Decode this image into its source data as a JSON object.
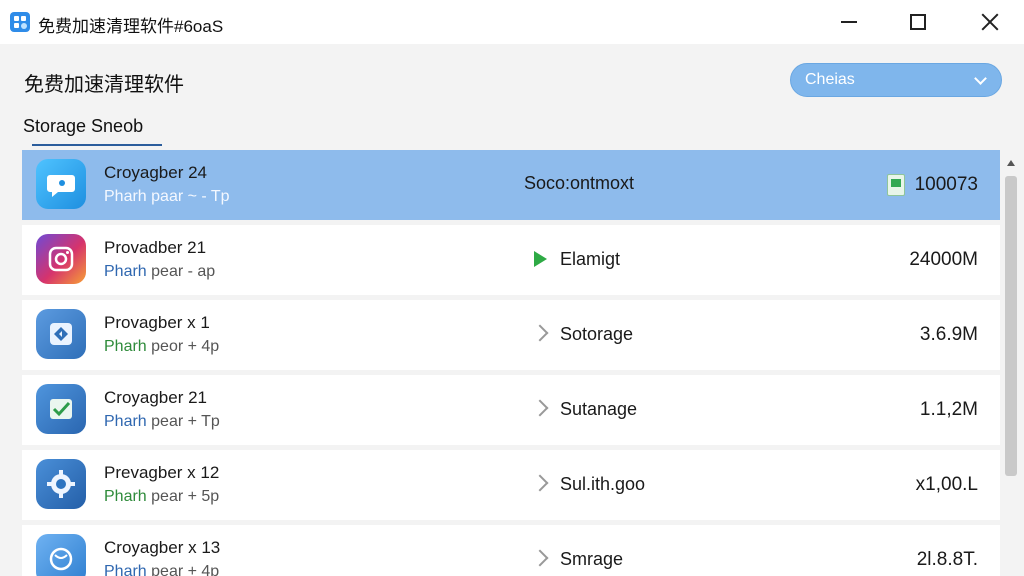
{
  "window": {
    "title": "免费加速清理软件#6oaS"
  },
  "header": {
    "title": "免费加速清理软件",
    "dropdown_value": "Cheias",
    "tab_label": "Storage Sneob"
  },
  "rows": [
    {
      "name": "Croyagber 24",
      "sub_prefix": "Pharh paar",
      "sub_suffix": " ~ - Tp",
      "middle": "Soco:ontmoxt",
      "middle_icon": "none",
      "right": "100073",
      "right_icon": "file-icon",
      "icon": "chat-bubble-icon",
      "icon_color": "#1fa3e8",
      "selected": true
    },
    {
      "name": "Provadber 21",
      "sub_prefix": "Pharh",
      "sub_suffix": " pear - ap",
      "middle": "Elamigt",
      "middle_icon": "play-icon",
      "right": "24000M",
      "right_icon": "none",
      "icon": "instagram-icon",
      "icon_color": "#d6336c",
      "selected": false
    },
    {
      "name": "Provagber x 1",
      "sub_prefix": "Pharh",
      "sub_suffix": " peor + 4p",
      "middle": "Sotorage",
      "middle_icon": "chevron-right-icon",
      "right": "3.6.9M",
      "right_icon": "none",
      "icon": "diamond-tile-icon",
      "icon_color": "#3f7fc8",
      "selected": false
    },
    {
      "name": "Croyagber 21",
      "sub_prefix": "Pharh",
      "sub_suffix": " pear + Tp",
      "middle": "Sutanage",
      "middle_icon": "chevron-right-icon",
      "right": "1.1,2M",
      "right_icon": "none",
      "icon": "checkmark-tile-icon",
      "icon_color": "#2f7fc4",
      "selected": false
    },
    {
      "name": "Prevagber x 12",
      "sub_prefix": "Pharh",
      "sub_suffix": " pear + 5p",
      "middle": "Sul.ith.goo",
      "middle_icon": "chevron-right-icon",
      "right": "x1,00.L",
      "right_icon": "none",
      "icon": "gear-tile-icon",
      "icon_color": "#2d74c0",
      "selected": false
    },
    {
      "name": "Croyagber x 13",
      "sub_prefix": "Pharh",
      "sub_suffix": " pear + 4p",
      "middle": "Smrage",
      "middle_icon": "chevron-right-icon",
      "right": "2l.8.8T.",
      "right_icon": "none",
      "icon": "globe-tile-icon",
      "icon_color": "#3b8fdf",
      "selected": false
    }
  ]
}
